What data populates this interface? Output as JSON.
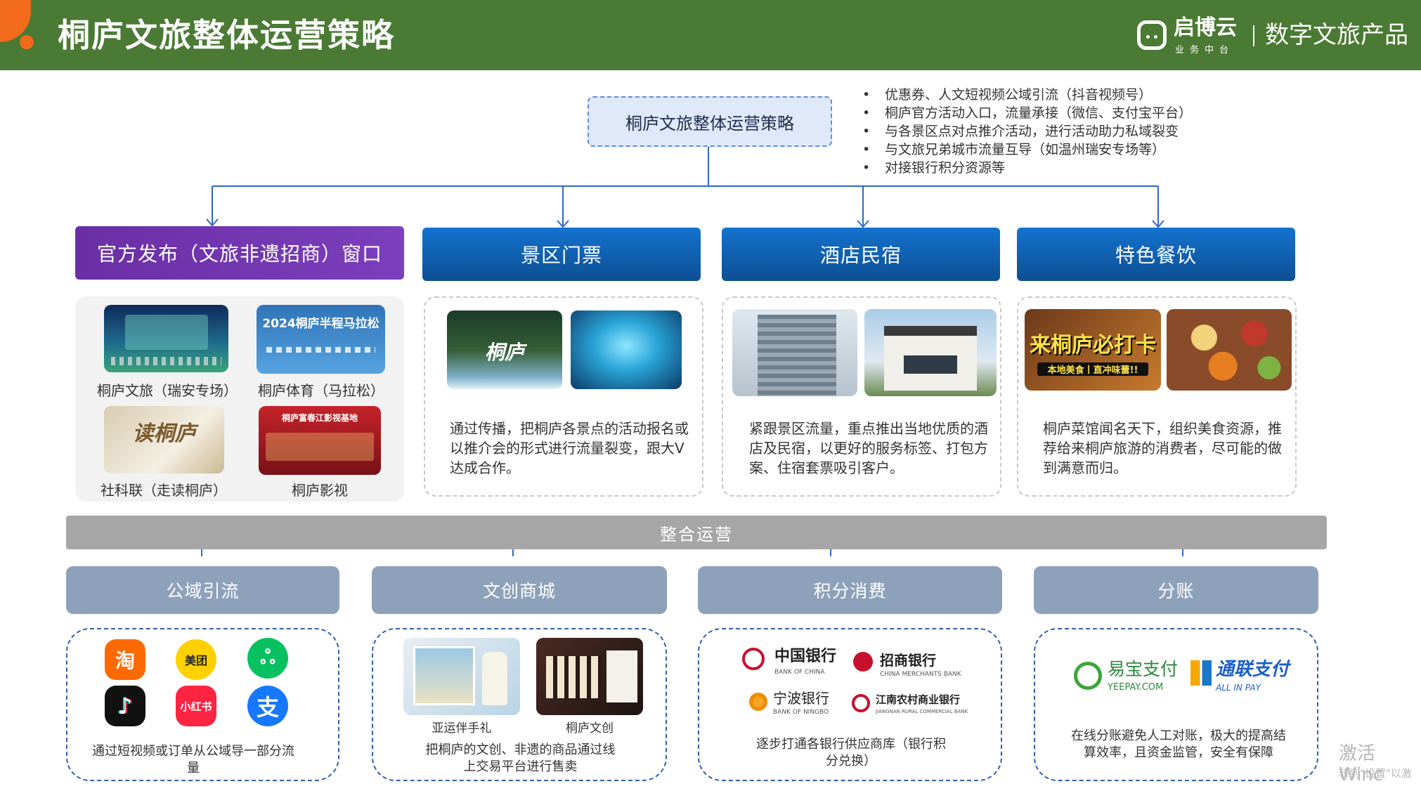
{
  "header": {
    "title": "桐庐文旅整体运营策略",
    "logo_name": "启博云",
    "logo_sub": "业务中台",
    "product": "数字文旅产品"
  },
  "strategy": {
    "root": "桐庐文旅整体运营策略",
    "bullets": [
      "优惠券、人文短视频公域引流（抖音视频号）",
      "桐庐官方活动入口，流量承接（微信、支付宝平台）",
      "与各景区点对点推介活动，进行活动助力私域裂变",
      "与文旅兄弟城市流量互导（如温州瑞安专场等）",
      "对接银行积分资源等"
    ]
  },
  "categories": {
    "official": "官方发布（文旅非遗招商）窗口",
    "tickets": "景区门票",
    "hotels": "酒店民宿",
    "dining": "特色餐饮"
  },
  "official": {
    "items": [
      {
        "caption": "桐庐文旅（瑞安专场）"
      },
      {
        "caption": "桐庐体育（马拉松）",
        "image_text": "2024桐庐半程马拉松"
      },
      {
        "caption": "社科联（走读桐庐）",
        "image_text": "读桐庐"
      },
      {
        "caption": "桐庐影视",
        "image_text": "桐庐富春江影视基地"
      }
    ]
  },
  "tickets": {
    "image_text": "桐庐",
    "desc": "通过传播，把桐庐各景点的活动报名或以推介会的形式进行流量裂变，跟大V达成合作。"
  },
  "hotels": {
    "desc": "紧跟景区流量，重点推出当地优质的酒店及民宿，以更好的服务标签、打包方案、住宿套票吸引客户。"
  },
  "dining": {
    "image_text": "来桐庐必打卡",
    "image_sub": "本地美食丨直冲味蕾!!",
    "desc": "桐庐菜馆闻名天下，组织美食资源，推荐给来桐庐旅游的消费者，尽可能的做到满意而归。"
  },
  "integration": "整合运营",
  "subs": {
    "public": "公域引流",
    "mall": "文创商城",
    "points": "积分消费",
    "split": "分账"
  },
  "public_panel": {
    "apps": [
      {
        "name": "taobao-icon",
        "glyph": "淘",
        "color": "#ff6a00"
      },
      {
        "name": "meituan-icon",
        "glyph": "美团",
        "color": "#ffd100"
      },
      {
        "name": "wechat-channels-icon",
        "glyph": "ஃ",
        "color": "#07c160"
      },
      {
        "name": "douyin-icon",
        "glyph": "♪",
        "color": "#111111"
      },
      {
        "name": "xiaohongshu-icon",
        "glyph": "小红书",
        "color": "#ff2442"
      },
      {
        "name": "alipay-icon",
        "glyph": "支",
        "color": "#1677ff"
      }
    ],
    "desc": "通过短视频或订单从公域导一部分流量"
  },
  "mall_panel": {
    "items": [
      {
        "caption": "亚运伴手礼"
      },
      {
        "caption": "桐庐文创"
      }
    ],
    "desc": "把桐庐的文创、非遗的商品通过线上交易平台进行售卖"
  },
  "points_panel": {
    "banks": [
      {
        "name": "中国银行",
        "en": "BANK OF CHINA"
      },
      {
        "name": "招商银行",
        "en": "CHINA MERCHANTS BANK"
      },
      {
        "name": "宁波银行",
        "en": "BANK OF NINGBO"
      },
      {
        "name": "江南农村商业银行",
        "en": "JIANGNAN RURAL COMMERCIAL BANK"
      }
    ],
    "desc": "逐步打通各银行供应商库（银行积分兑换）"
  },
  "split_panel": {
    "payments": [
      {
        "name": "易宝支付",
        "en": "YEEPAY.COM"
      },
      {
        "name": "通联支付",
        "en": "ALL IN PAY"
      }
    ],
    "desc": "在线分账避免人工对账，极大的提高结算效率，且资金监管，安全有保障"
  },
  "watermark": {
    "line1": "激活 Winc",
    "line2": "转到\"设置\"以激"
  },
  "colors": {
    "header_green": "#4a7a33",
    "accent_orange": "#f26a1b",
    "category_purple": "#6a2ea5",
    "category_blue": "#0d4f93",
    "connector_blue": "#2f66c9",
    "sub_header_grey_blue": "#8ea1ba",
    "integration_grey": "#a6a6a6"
  }
}
